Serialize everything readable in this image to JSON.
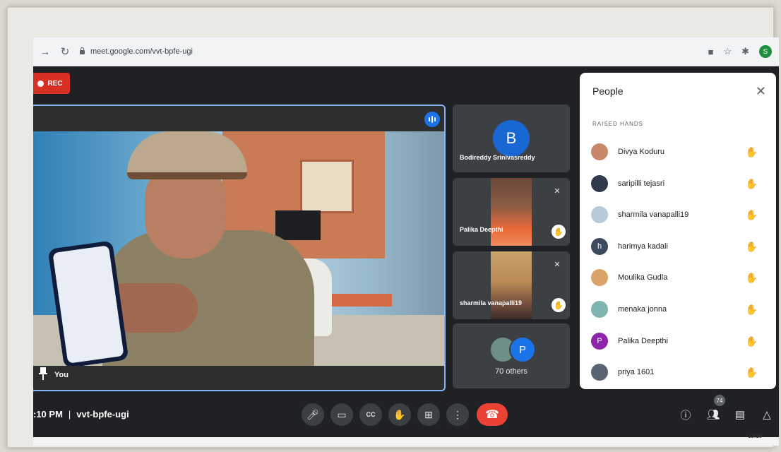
{
  "browser": {
    "url": "meet.google.com/vvt-bpfe-ugi",
    "profile_initial": "S"
  },
  "recording": {
    "label": "REC"
  },
  "main_tile": {
    "name": "You"
  },
  "tiles": [
    {
      "name": "Bodireddy Srinivasreddy",
      "avatar_letter": "B",
      "avatar_color": "#1967d2"
    },
    {
      "name": "Palika Deepthi"
    },
    {
      "name": "sharmila vanapalli19"
    }
  ],
  "others": {
    "label": "70 others",
    "avatar_letter": "P"
  },
  "people_panel": {
    "title": "People",
    "section_label": "RAISED HANDS",
    "people": [
      {
        "name": "Divya Koduru",
        "avatar_color": "#c9876b",
        "letter": ""
      },
      {
        "name": "saripilli tejasri",
        "avatar_color": "#2f3a4a",
        "letter": ""
      },
      {
        "name": "sharmila vanapalli19",
        "avatar_color": "#b8c9d8",
        "letter": ""
      },
      {
        "name": "harimya kadali",
        "avatar_color": "#3c4b5c",
        "letter": "h"
      },
      {
        "name": "Moulika Gudla",
        "avatar_color": "#d9a36a",
        "letter": ""
      },
      {
        "name": "menaka jonna",
        "avatar_color": "#7fb5b0",
        "letter": ""
      },
      {
        "name": "Palika Deepthi",
        "avatar_color": "#8e24aa",
        "letter": "P"
      },
      {
        "name": "priya 1601",
        "avatar_color": "#5a6472",
        "letter": ""
      }
    ]
  },
  "bottom": {
    "time": ":10 PM",
    "meeting_code": "vvt-bpfe-ugi",
    "participants_count": "74"
  },
  "taskbar": {
    "time": "13:10"
  },
  "colors": {
    "accent": "#8ab4f8",
    "end_call": "#ea4335",
    "rec": "#d93025"
  }
}
